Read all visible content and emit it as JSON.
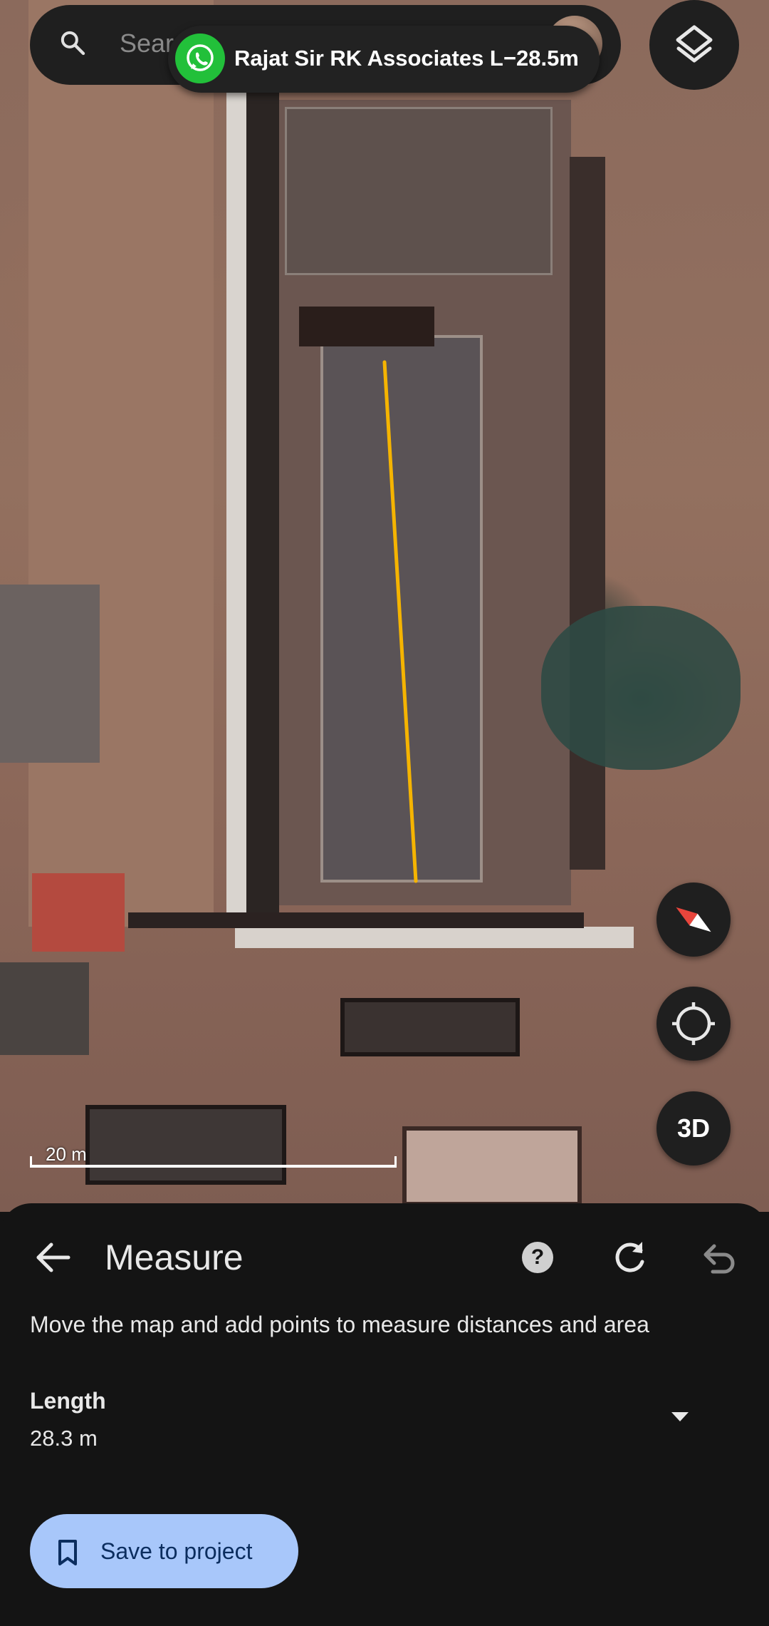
{
  "search": {
    "placeholder": "Sear"
  },
  "notification_chip": {
    "app_icon": "whatsapp-icon",
    "text": "Rajat Sir RK Associates  L−28.5m"
  },
  "map": {
    "type": "satellite",
    "scale_label": "20 m",
    "measure_line_color": "#f5b400",
    "controls": {
      "layers_icon": "layers-icon",
      "compass_icon": "compass-icon",
      "locate_icon": "my-location-icon",
      "view_3d_label": "3D"
    }
  },
  "measure": {
    "title": "Measure",
    "help_icon": "help-icon",
    "refresh_icon": "refresh-icon",
    "undo_icon": "undo-icon",
    "instructions": "Move the map and add points to measure distances and area",
    "length_label": "Length",
    "length_value": "28.3 m",
    "save_button_label": "Save to project",
    "save_icon": "bookmark-icon"
  },
  "colors": {
    "sheet_bg": "#141414",
    "accent_button": "#a8c7fa",
    "whatsapp_green": "#22c03a"
  }
}
